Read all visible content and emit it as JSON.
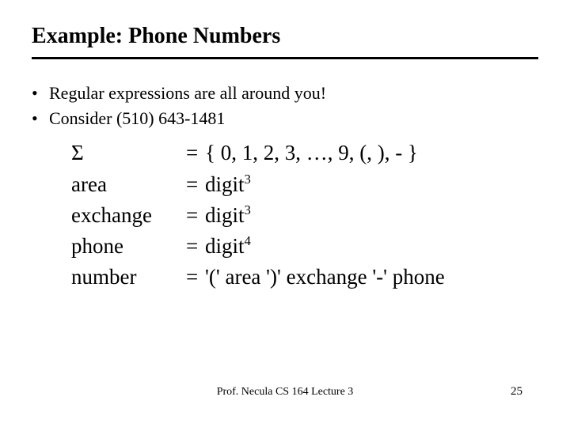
{
  "title": "Example: Phone Numbers",
  "bullets": [
    "Regular expressions are all around you!",
    "Consider (510) 643-1481"
  ],
  "defs": {
    "sigma": {
      "lhs": "Σ",
      "rhs": "{ 0, 1, 2, 3, …, 9, (, ), - }"
    },
    "area": {
      "lhs": "area",
      "rhs_base": "digit",
      "rhs_sup": "3"
    },
    "exchange": {
      "lhs": "exchange",
      "rhs_base": "digit",
      "rhs_sup": "3"
    },
    "phone": {
      "lhs": "phone",
      "rhs_base": "digit",
      "rhs_sup": "4"
    },
    "number": {
      "lhs": "number",
      "rhs": "'(' area ')' exchange '-' phone"
    }
  },
  "eq": "=",
  "footer": "Prof. Necula  CS 164  Lecture 3",
  "page": "25"
}
